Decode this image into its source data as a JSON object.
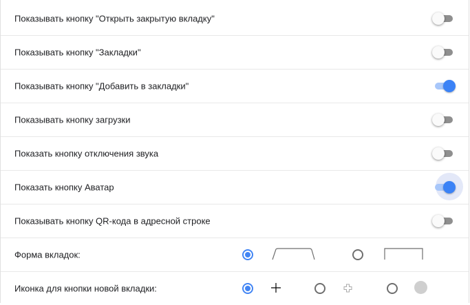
{
  "settings": [
    {
      "label": "Показывать кнопку \"Открыть закрытую вкладку\"",
      "on": false
    },
    {
      "label": "Показывать кнопку \"Закладки\"",
      "on": false
    },
    {
      "label": "Показывать кнопку \"Добавить в закладки\"",
      "on": true
    },
    {
      "label": "Показывать кнопку загрузки",
      "on": false
    },
    {
      "label": "Показать кнопку отключения звука",
      "on": false
    },
    {
      "label": "Показать кнопку Аватар",
      "on": true
    },
    {
      "label": "Показывать кнопку QR-кода в адресной строке",
      "on": false
    }
  ],
  "tab_shape": {
    "label": "Форма вкладок:",
    "options": [
      "rounded-trapezoid",
      "rectangle"
    ],
    "selected": 0
  },
  "new_tab_icon": {
    "label": "Иконка для кнопки новой вкладки:",
    "options": [
      "plus",
      "outlined-plus",
      "filled-circle"
    ],
    "selected": 0
  },
  "colors": {
    "accent": "#4285f4"
  }
}
